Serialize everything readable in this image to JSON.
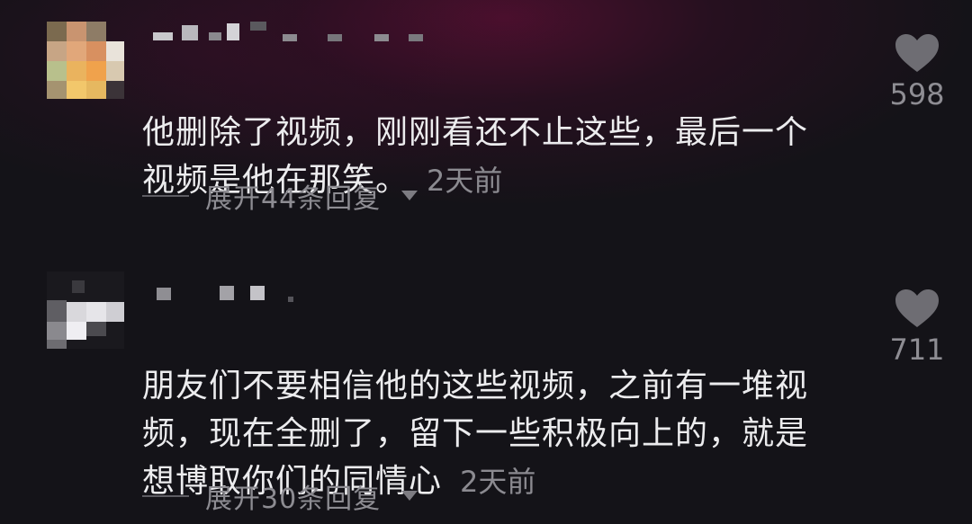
{
  "comments": [
    {
      "text": "他删除了视频，刚刚看还不止这些，最后一个\n视频是他在那笑。",
      "time": "2天前",
      "likes": "598",
      "expand_label": "展开44条回复"
    },
    {
      "text": "朋友们不要相信他的这些视频，之前有一堆视\n频，现在全删了，留下一些积极向上的，就是\n想博取你们的同情心",
      "time": "2天前",
      "likes": "711",
      "expand_label": "展开30条回复"
    }
  ],
  "colors": {
    "background": "#141318",
    "text": "#ececee",
    "muted": "#8b8a90",
    "heart": "#6e6d73"
  },
  "icons": {
    "like": "heart-icon",
    "expand": "chevron-down-icon"
  }
}
